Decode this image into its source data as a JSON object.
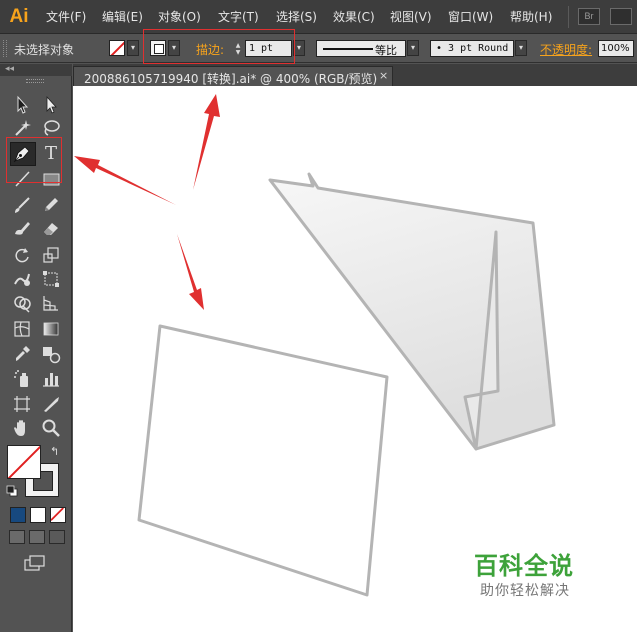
{
  "app": {
    "logo": "Ai"
  },
  "menubar": {
    "items": [
      "文件(F)",
      "编辑(E)",
      "对象(O)",
      "文字(T)",
      "选择(S)",
      "效果(C)",
      "视图(V)",
      "窗口(W)",
      "帮助(H)"
    ],
    "bridge_label": "Br"
  },
  "controlbar": {
    "selection_status": "未选择对象",
    "stroke_label": "描边:",
    "stroke_weight": "1 pt",
    "profile_label": "等比",
    "brush_label": "• 3 pt Round",
    "opacity_label": "不透明度:",
    "opacity_value": "100%",
    "fill_color": "none",
    "stroke_color": "none"
  },
  "document": {
    "tab_title": "200886105719940 [转换].ai* @ 400% (RGB/预览)",
    "close_glyph": "×"
  },
  "toolbox": {
    "type_tool_glyph": "T",
    "swap_glyph": "↰",
    "collapse_glyph": "◂◂"
  },
  "watermark": {
    "title": "百科全说",
    "subtitle": "助你轻松解决"
  },
  "colors": {
    "accent_orange": "#f7a31c",
    "annotation_red": "#e03030",
    "shape_stroke": "#b4b4b4",
    "watermark_green": "#3da23a"
  }
}
